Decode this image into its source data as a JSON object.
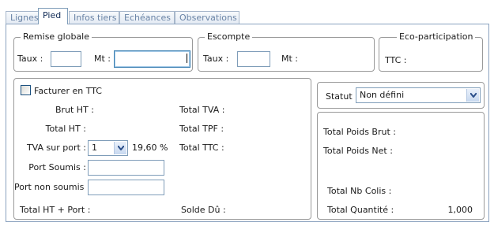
{
  "tabs": [
    {
      "label": "Lignes",
      "active": false
    },
    {
      "label": "Pied",
      "active": true
    },
    {
      "label": "Infos tiers",
      "active": false
    },
    {
      "label": "Echéances",
      "active": false
    },
    {
      "label": "Observations",
      "active": false
    }
  ],
  "remise": {
    "legend": "Remise globale",
    "taux_label": "Taux :",
    "taux_value": "",
    "mt_label": "Mt :",
    "mt_value": ""
  },
  "escompte": {
    "legend": "Escompte",
    "taux_label": "Taux :",
    "taux_value": "",
    "mt_label": "Mt :"
  },
  "eco": {
    "legend": "Eco-participation",
    "ttc_label": "TTC :"
  },
  "totals": {
    "facturer_ttc_label": "Facturer en TTC",
    "facturer_ttc_checked": false,
    "brut_ht_label": "Brut HT :",
    "total_ht_label": "Total HT :",
    "tva_port_label": "TVA sur port :",
    "tva_port_value": "1",
    "tva_rate": "19,60 %",
    "port_soumis_label": "Port Soumis :",
    "port_soumis_value": "",
    "port_non_soumis_label": "Port non soumis :",
    "port_non_soumis_value": "",
    "total_ht_port_label": "Total HT + Port :",
    "total_tva_label": "Total TVA :",
    "total_tpf_label": "Total TPF :",
    "total_ttc_label": "Total TTC :",
    "solde_du_label": "Solde Dû :"
  },
  "statut": {
    "label": "Statut :",
    "value": "Non défini"
  },
  "poids": {
    "brut_label": "Total Poids Brut :",
    "net_label": "Total Poids Net :",
    "nb_colis_label": "Total Nb Colis :",
    "quantite_label": "Total Quantité :",
    "quantite_value": "1,000"
  }
}
